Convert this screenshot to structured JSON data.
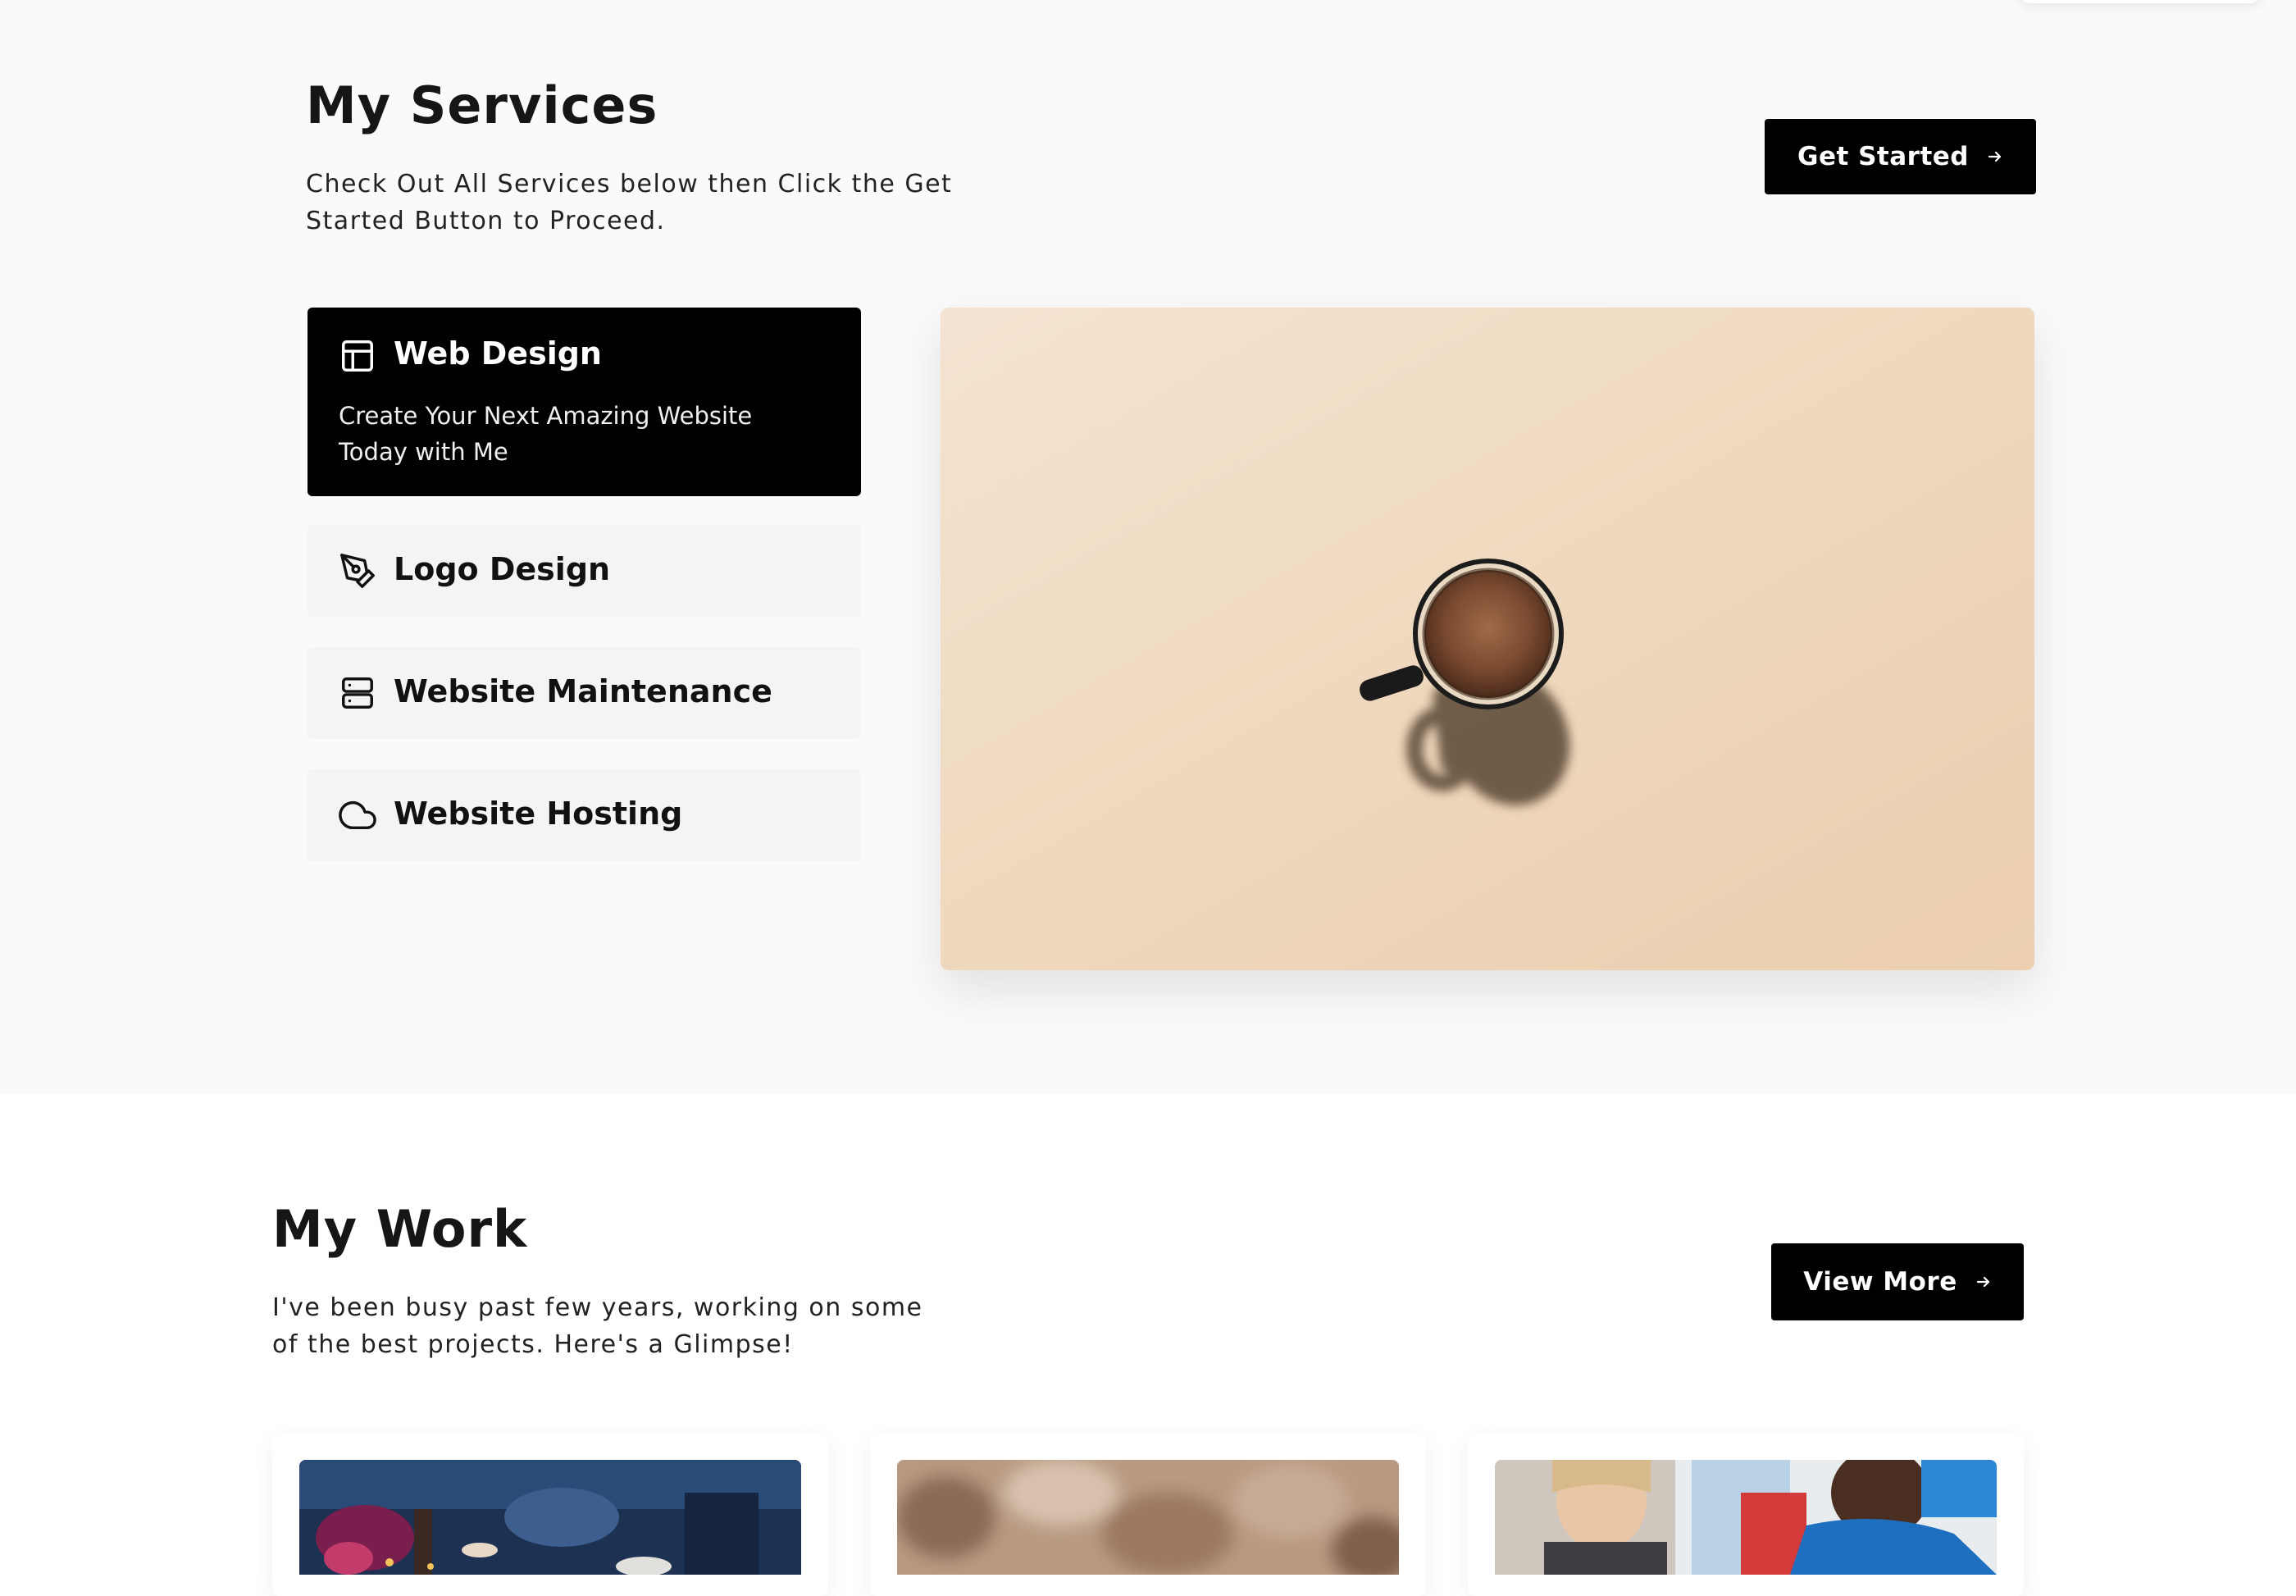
{
  "services": {
    "title": "My Services",
    "subtitle_line1": "Check Out All Services below then Click the Get",
    "subtitle_line2": "Started Button to Proceed.",
    "cta_label": "Get Started",
    "items": [
      {
        "label": "Web Design",
        "icon": "layout-icon",
        "active": true,
        "description_line1": "Create Your Next Amazing Website",
        "description_line2": "Today with Me"
      },
      {
        "label": "Logo Design",
        "icon": "pen-tool-icon",
        "active": false
      },
      {
        "label": "Website Maintenance",
        "icon": "server-icon",
        "active": false
      },
      {
        "label": "Website Hosting",
        "icon": "cloud-icon",
        "active": false
      }
    ],
    "image": "coffee-cup-photo"
  },
  "work": {
    "title": "My Work",
    "subtitle_line1": "I've been busy past few years, working on some",
    "subtitle_line2": "of the best projects. Here's a Glimpse!",
    "cta_label": "View More",
    "projects": [
      {
        "image": "dinner-party-photo"
      },
      {
        "image": "blurred-crowd-photo"
      },
      {
        "image": "students-classroom-photo"
      }
    ]
  },
  "colors": {
    "accent": "#000000",
    "section_bg": "#fafafa",
    "card_bg": "#f4f4f4",
    "panel_bg": "#efd9bf"
  }
}
